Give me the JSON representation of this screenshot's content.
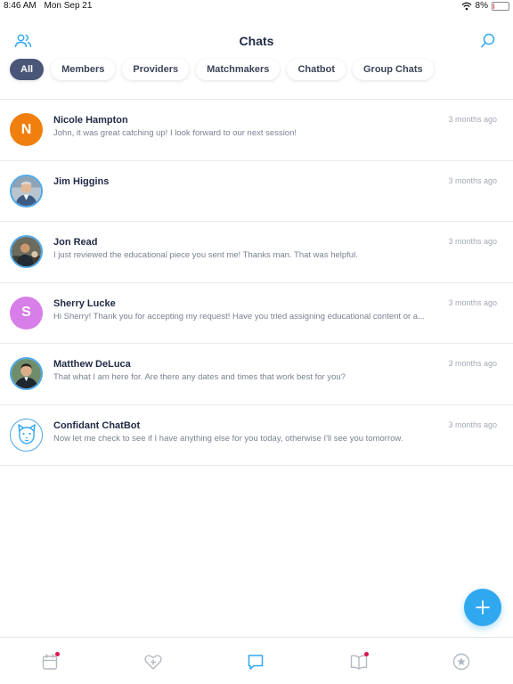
{
  "status_bar": {
    "time": "8:46 AM",
    "date": "Mon Sep 21",
    "battery": "8%",
    "battery_level": 0.08
  },
  "header": {
    "title": "Chats",
    "left_icon": "members-icon",
    "right_icon": "search-icon"
  },
  "tabs": [
    {
      "label": "All",
      "active": true
    },
    {
      "label": "Members"
    },
    {
      "label": "Providers"
    },
    {
      "label": "Matchmakers"
    },
    {
      "label": "Chatbot"
    },
    {
      "label": "Group Chats"
    }
  ],
  "chats": [
    {
      "name": "Nicole Hampton",
      "preview": "John, it was great catching up!  I look forward to our next session!",
      "time": "3 months ago",
      "avatar": {
        "type": "initial",
        "text": "N",
        "color": "#f07f0e"
      }
    },
    {
      "name": "Jim Higgins",
      "preview": "",
      "time": "3 months ago",
      "avatar": {
        "type": "photo"
      }
    },
    {
      "name": "Jon Read",
      "preview": "I just reviewed the educational piece you sent me!  Thanks man. That was helpful.",
      "time": "3 months ago",
      "avatar": {
        "type": "photo"
      }
    },
    {
      "name": "Sherry Lucke",
      "preview": "Hi Sherry!  Thank you for accepting my request!  Have you tried assigning educational content or a...",
      "time": "3 months ago",
      "avatar": {
        "type": "initial",
        "text": "S",
        "color": "#d77ee8"
      }
    },
    {
      "name": "Matthew DeLuca",
      "preview": "That what I am here for. Are there any dates and times that work best for you?",
      "time": "3 months ago",
      "avatar": {
        "type": "photo"
      }
    },
    {
      "name": "Confidant ChatBot",
      "preview": "Now let me check to see if I have anything else for you today, otherwise I'll see you tomorrow.",
      "time": "3 months ago",
      "avatar": {
        "type": "bot"
      }
    }
  ],
  "fab": {
    "icon": "plus-icon"
  },
  "bottom_nav": [
    {
      "icon": "calendar-icon",
      "badge": true
    },
    {
      "icon": "heart-plus-icon",
      "badge": false
    },
    {
      "icon": "chat-icon",
      "badge": false,
      "active": true
    },
    {
      "icon": "book-icon",
      "badge": true
    },
    {
      "icon": "star-icon",
      "badge": false
    }
  ],
  "colors": {
    "accent": "#2fa8ef",
    "active_tab": "#4a5678",
    "title": "#1f2a44",
    "badge": "#e0134f"
  }
}
